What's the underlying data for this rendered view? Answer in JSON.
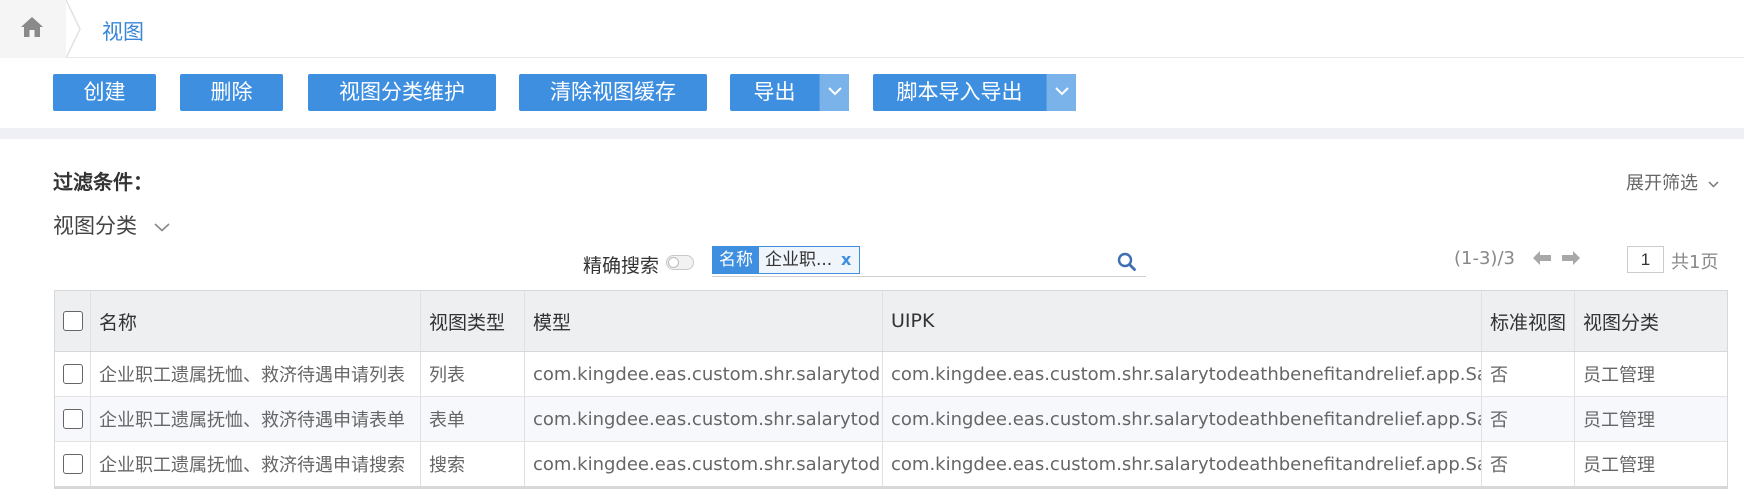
{
  "breadcrumb": {
    "home_icon": "home-icon",
    "current": "视图"
  },
  "toolbar": {
    "create": "创建",
    "delete": "删除",
    "category_maintain": "视图分类维护",
    "clear_cache": "清除视图缓存",
    "export": "导出",
    "script_import_export": "脚本导入导出"
  },
  "filter": {
    "label": "过滤条件：",
    "expand": "展开筛选",
    "category": "视图分类"
  },
  "search": {
    "exact_label": "精确搜索",
    "exact_enabled": false,
    "tag_key": "名称",
    "tag_value": "企业职...",
    "tag_remove": "x",
    "placeholder": ""
  },
  "pager": {
    "range": "(1-3)/3",
    "page": "1",
    "total": "共1页"
  },
  "table": {
    "columns": [
      "名称",
      "视图类型",
      "模型",
      "UIPK",
      "标准视图",
      "视图分类"
    ],
    "rows": [
      [
        "企业职工遗属抚恤、救济待遇申请列表",
        "列表",
        "com.kingdee.eas.custom.shr.salarytod...",
        "com.kingdee.eas.custom.shr.salarytodeathbenefitandrelief.app.Sal...",
        "否",
        "员工管理"
      ],
      [
        "企业职工遗属抚恤、救济待遇申请表单",
        "表单",
        "com.kingdee.eas.custom.shr.salarytod...",
        "com.kingdee.eas.custom.shr.salarytodeathbenefitandrelief.app.Sal...",
        "否",
        "员工管理"
      ],
      [
        "企业职工遗属抚恤、救济待遇申请搜索",
        "搜索",
        "com.kingdee.eas.custom.shr.salarytod...",
        "com.kingdee.eas.custom.shr.salarytodeathbenefitandrelief.app.Sal...",
        "否",
        "员工管理"
      ]
    ]
  },
  "colors": {
    "accent": "#3e8fe0",
    "caret": "#7ab3ea",
    "link": "#3a86d6",
    "gap": "#eef0f6"
  }
}
